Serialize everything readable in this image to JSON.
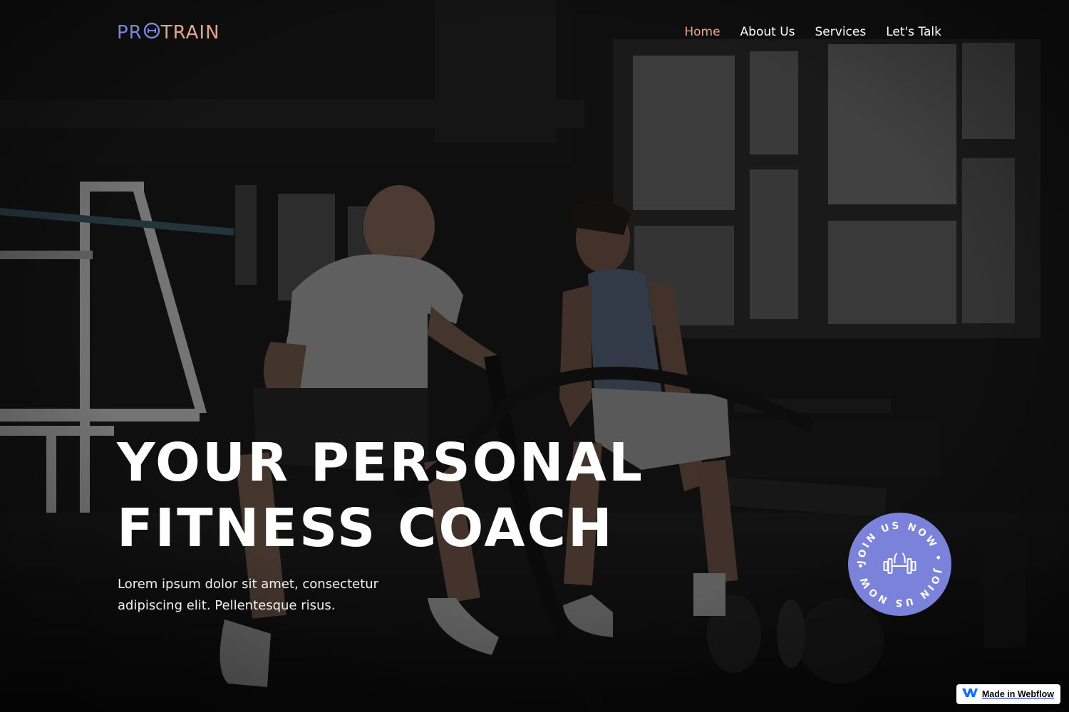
{
  "brand": {
    "logo_left": "PR",
    "logo_mid": "O",
    "logo_right": "TRAIN",
    "logo_full": "PROTRAIN",
    "colors": {
      "primary": "#7d86d9",
      "accent": "#e0a592"
    }
  },
  "nav": {
    "items": [
      {
        "label": "Home",
        "active": true
      },
      {
        "label": "About Us",
        "active": false
      },
      {
        "label": "Services",
        "active": false
      },
      {
        "label": "Let's Talk",
        "active": false
      }
    ]
  },
  "hero": {
    "title_line1": "YOUR PERSONAL",
    "title_line2": "FITNESS COACH",
    "subtitle": "Lorem ipsum dolor sit amet, consectetur adipiscing elit. Pellentesque risus.",
    "background_image": "dark gym scene with two people doing battle-rope training"
  },
  "join_badge": {
    "text": "JOIN US NOW • JOIN US NOW •",
    "icon": "dumbbell-icon",
    "color": "#7b82d9"
  },
  "webflow_badge": {
    "label": "Made in Webflow",
    "icon": "webflow-logo-icon"
  }
}
